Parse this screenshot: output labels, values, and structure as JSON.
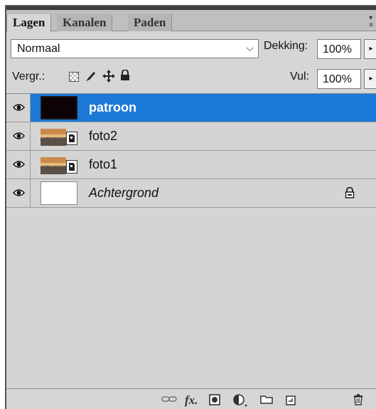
{
  "tabs": [
    {
      "label": "Lagen",
      "active": true
    },
    {
      "label": "Kanalen",
      "active": false
    },
    {
      "label": "Paden",
      "active": false
    }
  ],
  "blend_mode": {
    "value": "Normaal"
  },
  "opacity": {
    "label": "Dekking:",
    "value": "100%"
  },
  "lock": {
    "label": "Vergr.:",
    "icons": [
      "lock-transparent-pixels-icon",
      "lock-image-pixels-icon",
      "lock-position-icon",
      "lock-all-icon"
    ]
  },
  "fill": {
    "label": "Vul:",
    "value": "100%"
  },
  "layers": [
    {
      "name": "patroon",
      "selected": true,
      "thumb": "black",
      "smart": false,
      "locked": false,
      "italic": false
    },
    {
      "name": "foto2",
      "selected": false,
      "thumb": "photo",
      "smart": true,
      "locked": false,
      "italic": false
    },
    {
      "name": "foto1",
      "selected": false,
      "thumb": "photo",
      "smart": true,
      "locked": false,
      "italic": false
    },
    {
      "name": "Achtergrond",
      "selected": false,
      "thumb": "white",
      "smart": false,
      "locked": true,
      "italic": true
    }
  ],
  "footer_icons": [
    "link-layers-icon",
    "fx-icon",
    "add-mask-icon",
    "adjustment-layer-icon",
    "new-group-icon",
    "new-layer-icon",
    "delete-layer-icon"
  ],
  "colors": {
    "selection": "#1d79d8",
    "panel_bg": "#d6d6d6"
  }
}
